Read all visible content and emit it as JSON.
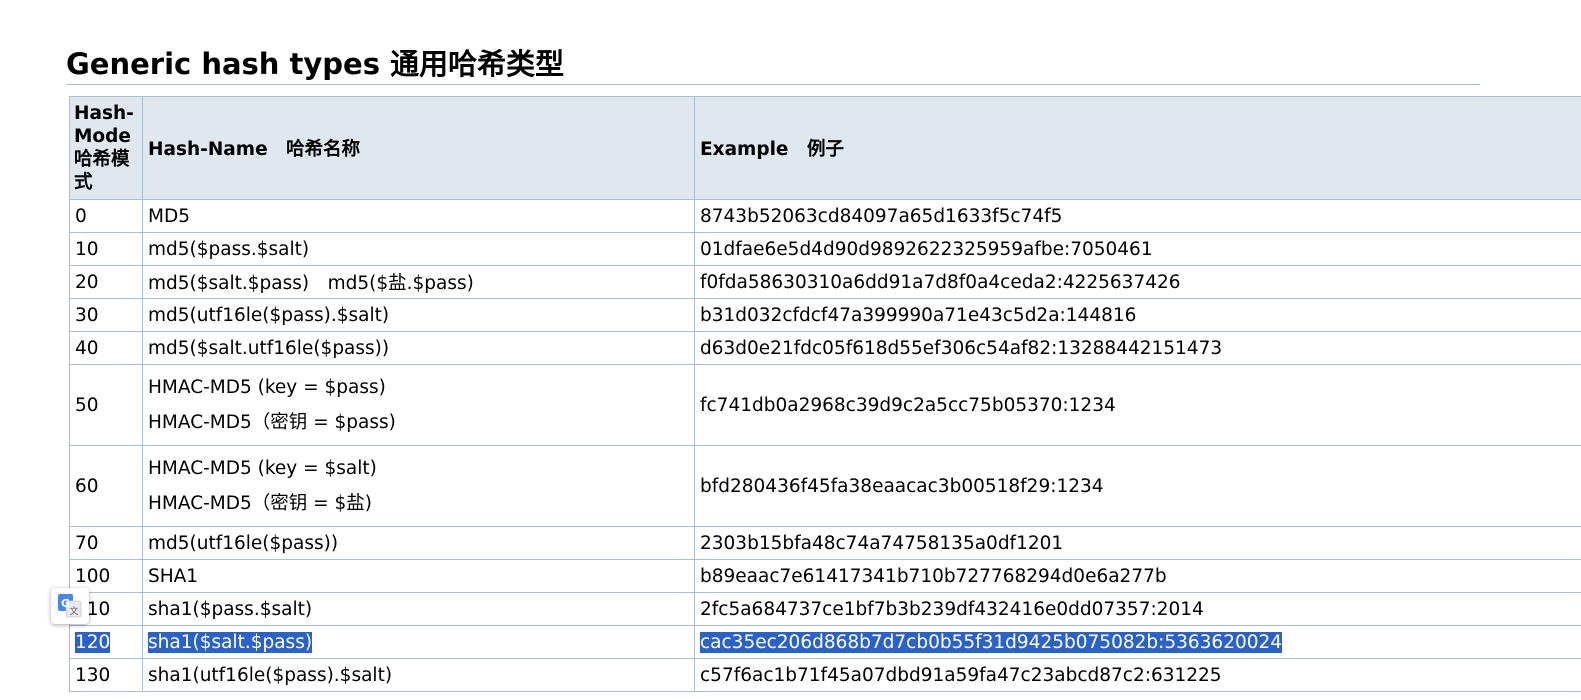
{
  "page": {
    "title": "Generic hash types 通用哈希类型"
  },
  "table": {
    "headers": {
      "mode": "Hash-Mode 哈希模式",
      "name": "Hash-Name　哈希名称",
      "example": "Example　例子"
    },
    "rows": [
      {
        "mode": "0",
        "names": [
          "MD5"
        ],
        "example": "8743b52063cd84097a65d1633f5c74f5"
      },
      {
        "mode": "10",
        "names": [
          "md5($pass.$salt)"
        ],
        "example": "01dfae6e5d4d90d9892622325959afbe:7050461"
      },
      {
        "mode": "20",
        "names": [
          "md5($salt.$pass)　md5($盐.$pass)"
        ],
        "example": "f0fda58630310a6dd91a7d8f0a4ceda2:4225637426"
      },
      {
        "mode": "30",
        "names": [
          "md5(utf16le($pass).$salt)"
        ],
        "example": "b31d032cfdcf47a399990a71e43c5d2a:144816"
      },
      {
        "mode": "40",
        "names": [
          "md5($salt.utf16le($pass))"
        ],
        "example": "d63d0e21fdc05f618d55ef306c54af82:13288442151473"
      },
      {
        "mode": "50",
        "names": [
          "HMAC-MD5 (key = $pass)",
          "HMAC-MD5（密钥 = $pass)"
        ],
        "example": "fc741db0a2968c39d9c2a5cc75b05370:1234"
      },
      {
        "mode": "60",
        "names": [
          "HMAC-MD5 (key = $salt)",
          "HMAC-MD5（密钥 = $盐)"
        ],
        "example": "bfd280436f45fa38eaacac3b00518f29:1234"
      },
      {
        "mode": "70",
        "names": [
          "md5(utf16le($pass))"
        ],
        "example": "2303b15bfa48c74a74758135a0df1201"
      },
      {
        "mode": "100",
        "names": [
          "SHA1"
        ],
        "example": "b89eaac7e61417341b710b727768294d0e6a277b"
      },
      {
        "mode": "110",
        "names": [
          "sha1($pass.$salt)"
        ],
        "example": "2fc5a684737ce1bf7b3b239df432416e0dd07357:2014"
      },
      {
        "mode": "120",
        "names": [
          "sha1($salt.$pass)"
        ],
        "example": "cac35ec206d868b7d7cb0b55f31d9425b075082b:5363620024",
        "selected": true
      },
      {
        "mode": "130",
        "names": [
          "sha1(utf16le($pass).$salt)"
        ],
        "example": "c57f6ac1b71f45a07dbd91a59fa47c23abcd87c2:631225"
      }
    ]
  },
  "widgets": {
    "translate_icon": "google-translate-icon"
  },
  "colors": {
    "header_bg": "#e1e7ee",
    "border": "#a7c0d6",
    "selection_bg": "#2b62c9",
    "selection_text": "#ffffff"
  }
}
